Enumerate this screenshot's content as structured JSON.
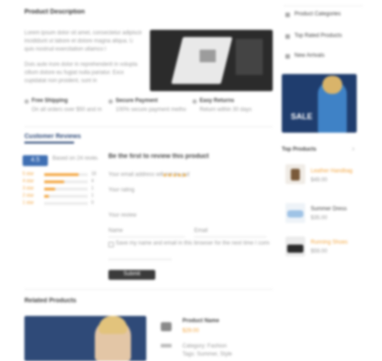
{
  "product": {
    "title": "Product Description",
    "description_lines": [
      "Lorem ipsum dolor sit amet, consectetur adipiscing elit, sed do eiusmod tempor",
      "incididunt ut labore et dolore magna aliqua. Ut enim ad minim veniam,",
      "quis nostrud exercitation ullamco laboris nisi ut aliquip.",
      "Duis aute irure dolor in reprehenderit in voluptate velit esse",
      "cillum dolore eu fugiat nulla pariatur. Excepteur sint occaecat",
      "cupidatat non proident, sunt in culpa qui officia."
    ],
    "features": [
      {
        "title": "Free Shipping",
        "text": "On all orders over $50 and more"
      },
      {
        "title": "Secure Payment",
        "text": "100% secure payment methods"
      },
      {
        "title": "Easy Returns",
        "text": "Return within 30 days"
      }
    ]
  },
  "reviews": {
    "title": "Customer Reviews",
    "average": "4.5",
    "count_text": "Based on 24 reviews",
    "bars": [
      {
        "label": "5 star",
        "fraction": 0.8,
        "count": "18"
      },
      {
        "label": "4 star",
        "fraction": 0.45,
        "count": "4"
      },
      {
        "label": "3 star",
        "fraction": 0.25,
        "count": "1"
      },
      {
        "label": "2 star",
        "fraction": 0.1,
        "count": "1"
      },
      {
        "label": "1 star",
        "fraction": 0.0,
        "count": "0"
      }
    ]
  },
  "review_form": {
    "title": "Be the first to review this product",
    "subtitle": "Your email address will not be published.",
    "rating_label": "Your rating",
    "name_placeholder": "Name",
    "email_placeholder": "Email",
    "checkbox_label": "Save my name and email in this browser for the next time I comment.",
    "comment_label": "Your review",
    "submit_label": "Submit"
  },
  "related": {
    "title": "Related Products",
    "item": {
      "label": "Product Name",
      "price": "$29.00",
      "meta1": "Category: Fashion",
      "meta2": "Tags: Summer, Style"
    }
  },
  "sidebar": {
    "links": [
      "Product Categories",
      "Top Rated Products",
      "New Arrivals"
    ],
    "banner_text": "SALE",
    "products_title": "Top Products",
    "products": [
      {
        "name": "Leather Handbag",
        "price": "$49.00"
      },
      {
        "name": "Summer Dress",
        "price": "$35.00"
      },
      {
        "name": "Running Shoes",
        "price": "$59.00"
      }
    ]
  },
  "colors": {
    "accent": "#f3a640",
    "dark": "#3b3b3b",
    "blue": "#2f4a78"
  }
}
